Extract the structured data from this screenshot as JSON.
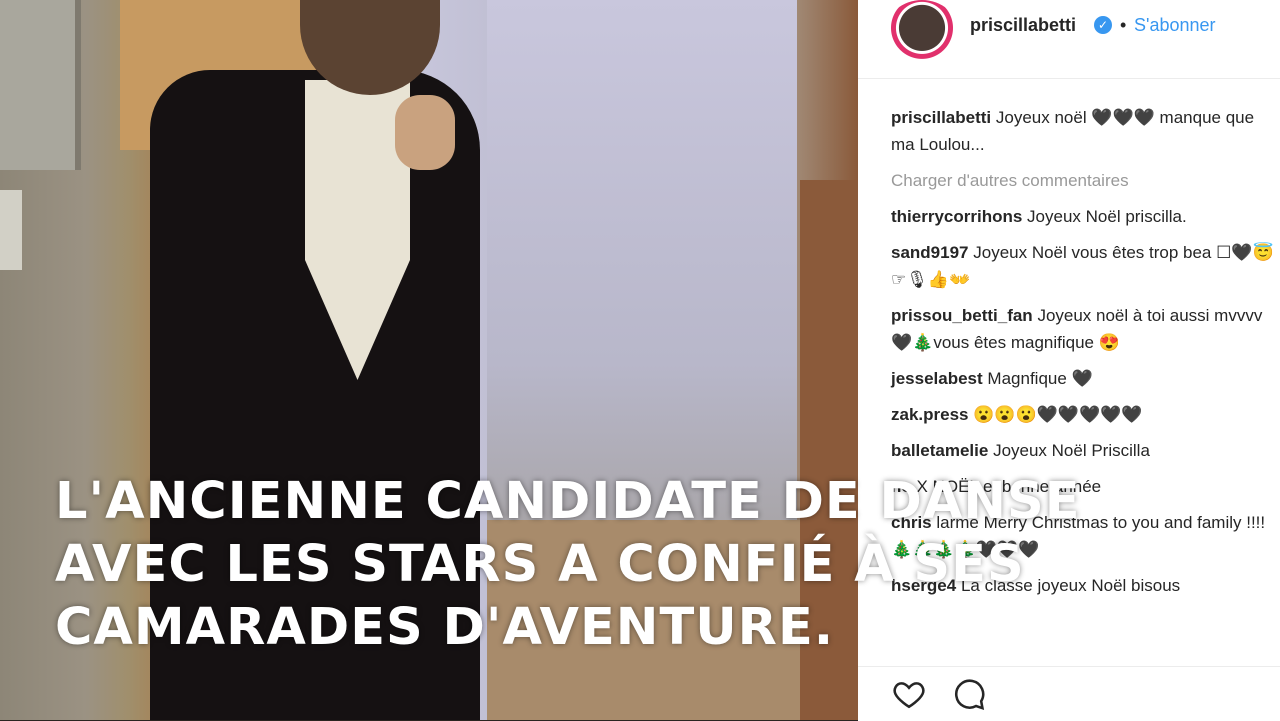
{
  "caption": {
    "lines": [
      "L'ANCIENNE CANDIDATE DE DANSE",
      "AVEC LES STARS A CONFIÉ À SES",
      "CAMARADES D'AVENTURE."
    ]
  },
  "post": {
    "username": "priscillabetti",
    "follow_label": "S'abonner",
    "separator": "•",
    "caption_user": "priscillabetti",
    "caption_text": "Joyeux noël 🖤🖤🖤 manque que ma Loulou...",
    "load_more": "Charger d'autres commentaires",
    "comments": [
      {
        "user": "thierrycorrihons",
        "text": "Joyeux Noël priscilla."
      },
      {
        "user": "sand9197",
        "text": "Joyeux Noël vous êtes trop bea ☐🖤😇☞🎙👍👐"
      },
      {
        "user": "prissou_betti_fan",
        "text": "Joyeux noël à toi aussi mvvvv🖤🎄vous êtes magnifique 😍"
      },
      {
        "user": "jesselabest",
        "text": "Magnfique 🖤"
      },
      {
        "user": "zak.press",
        "text": "😮😮😮🖤🖤🖤🖤🖤"
      },
      {
        "user": "balletamelie",
        "text": "Joyeux Noël Priscilla"
      },
      {
        "user": "no",
        "text": "X NOËL et bonne année"
      },
      {
        "user": "chris",
        "text": "larme Merry Christmas to you and family !!!!🎄🎄🎄🎄🖤🖤🖤"
      },
      {
        "user": "hserge4",
        "text": "La classe joyeux Noël bisous"
      }
    ]
  },
  "colors": {
    "link_blue": "#3897f0",
    "muted": "#999999",
    "text": "#262626"
  },
  "icons": {
    "like": "heart-icon",
    "comment": "comment-bubble-icon",
    "verified": "verified-badge-icon"
  }
}
